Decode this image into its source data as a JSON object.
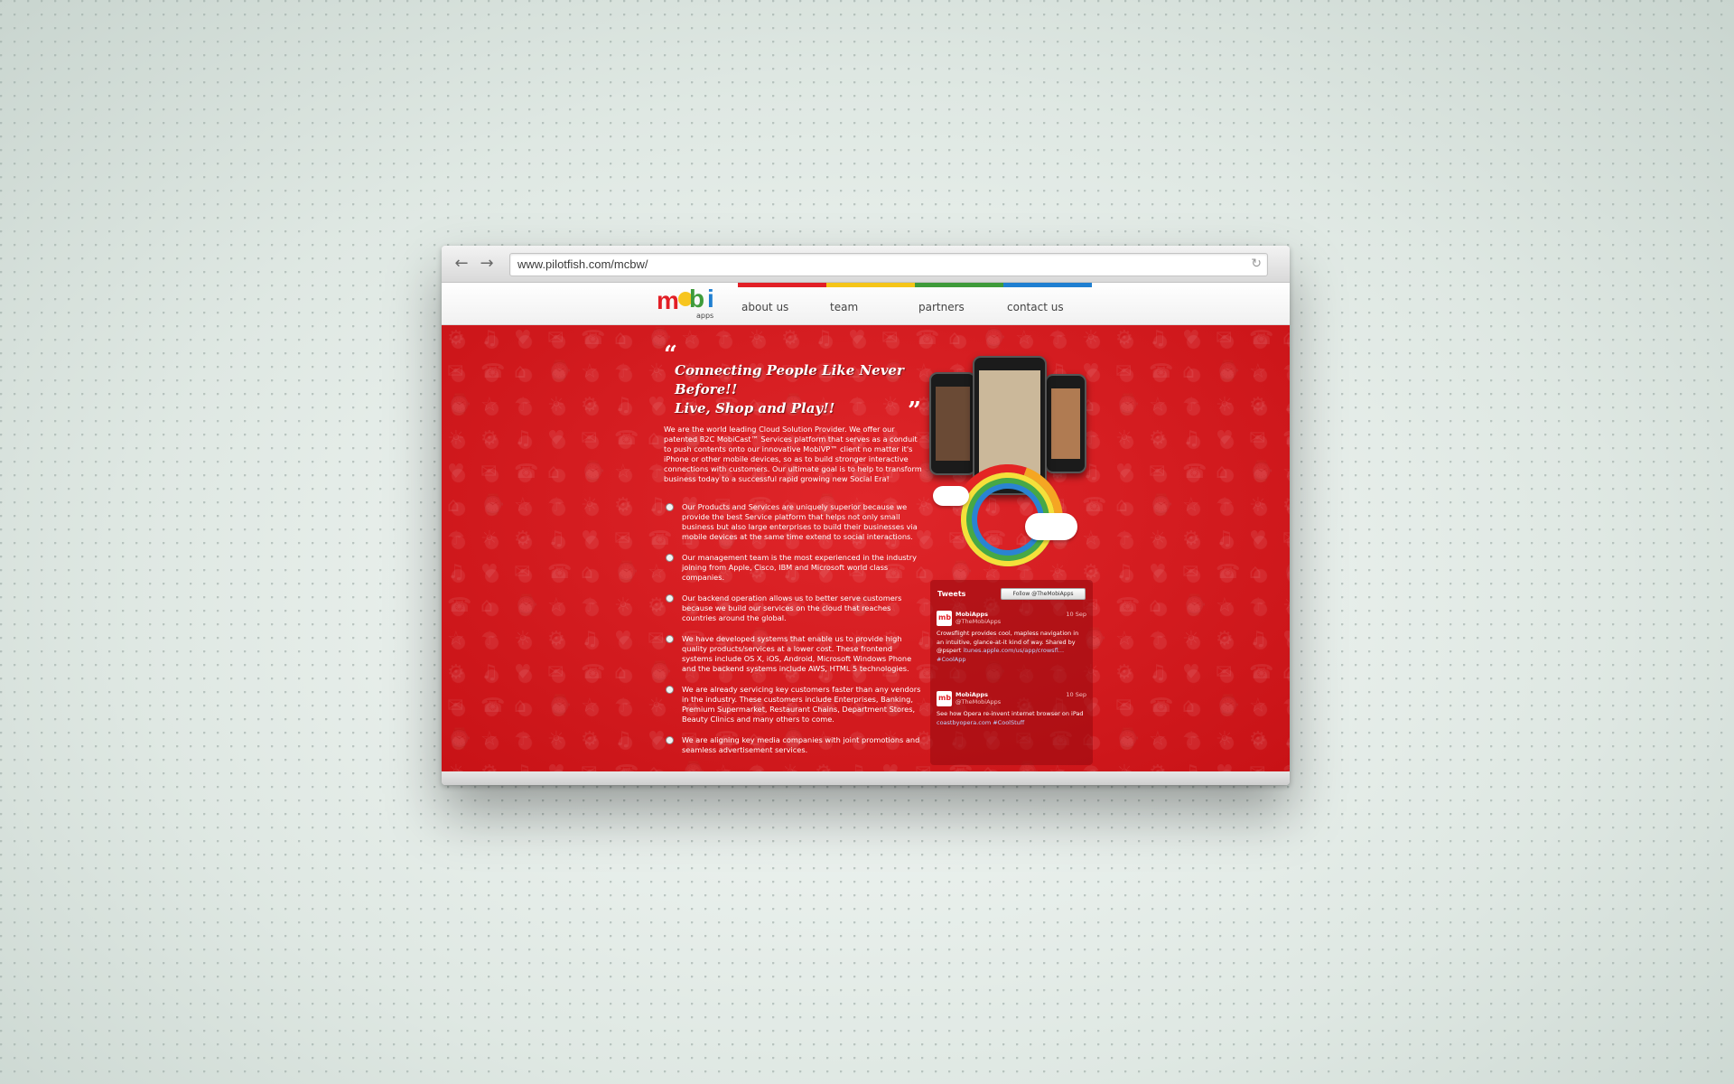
{
  "browser": {
    "url": "www.pilotfish.com/mcbw/",
    "back_icon": "arrow-left-icon",
    "forward_icon": "arrow-right-icon",
    "reload_icon": "reload-icon"
  },
  "site": {
    "logo": {
      "letters": [
        "m",
        "b",
        "i"
      ],
      "sub": "apps"
    },
    "menu": [
      {
        "label": "about us",
        "color": "#e21f26"
      },
      {
        "label": "team",
        "color": "#f5c518"
      },
      {
        "label": "partners",
        "color": "#3e9b3a"
      },
      {
        "label": "contact us",
        "color": "#1f7fd1"
      }
    ]
  },
  "hero": {
    "headline_line1": "Connecting People Like Never Before!!",
    "headline_line2": "Live, Shop and Play!!",
    "intro": "We are the world leading Cloud Solution Provider. We offer our patented B2C MobiCast™ Services platform that serves as a conduit to push contents onto our innovative MobiVP™ client no matter it's iPhone or other mobile devices, so as to build stronger interactive connections with customers. Our ultimate goal is to help to transform business today to a successful rapid growing new Social Era!",
    "bullets": [
      "Our Products and Services are uniquely superior because we provide the best Service platform that helps not only small business but also large enterprises to build their businesses via mobile devices at the same time extend to social interactions.",
      "Our management team is the most experienced in the industry joining from Apple, Cisco, IBM and Microsoft world class companies.",
      "Our backend operation allows us to better serve customers because we build our services on the cloud that reaches countries around the global.",
      "We have developed systems that enable us to provide high quality products/services at a lower cost. These frontend systems include OS X, iOS, Android, Microsoft Windows Phone and the backend systems include AWS, HTML 5 technologies.",
      "We are already servicing key customers faster than any vendors in the industry. These customers include Enterprises, Banking, Premium Supermarket, Restaurant Chains, Department Stores, Beauty Clinics and many others to come.",
      "We are aligning key media companies with joint promotions and seamless advertisement services."
    ]
  },
  "tweets": {
    "title": "Tweets",
    "follow_label": "Follow @TheMobiApps",
    "items": [
      {
        "name": "MobiApps",
        "handle": "@TheMobiApps",
        "date": "10 Sep",
        "text": "Crowsflight provides cool, mapless navigation in an intuitive, glance-at-it kind of way. Shared by @pspert",
        "link": "itunes.apple.com/us/app/crowsfl…",
        "tag": "#CoolApp"
      },
      {
        "name": "MobiApps",
        "handle": "@TheMobiApps",
        "date": "10 Sep",
        "text": "See how Opera re-invent internet browser on iPad",
        "link": "coastbyopera.com",
        "tag": "#CoolStuff"
      }
    ]
  }
}
